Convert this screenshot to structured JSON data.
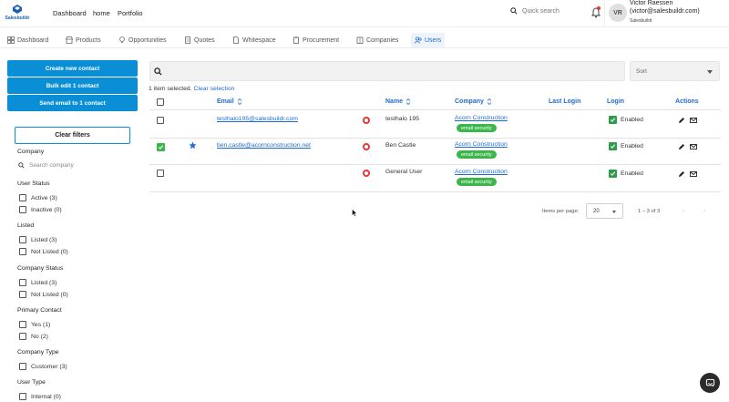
{
  "brand": {
    "logo_text": "Salesbuildr"
  },
  "nav": {
    "items": [
      "Dashboard",
      "home",
      "Portfolio"
    ]
  },
  "search": {
    "placeholder": "Quick search"
  },
  "user": {
    "initials": "VR",
    "name": "Victor Raessen",
    "email": "(victor@salesbuildr.com)",
    "company": "Salesbuildr"
  },
  "tabs": [
    {
      "label": "Dashboard",
      "icon": "grid-icon"
    },
    {
      "label": "Products",
      "icon": "store-icon"
    },
    {
      "label": "Opportunities",
      "icon": "lightbulb-icon"
    },
    {
      "label": "Quotes",
      "icon": "document-icon"
    },
    {
      "label": "Whitespace",
      "icon": "page-icon"
    },
    {
      "label": "Procurement",
      "icon": "clipboard-icon"
    },
    {
      "label": "Companies",
      "icon": "building-icon"
    },
    {
      "label": "Users",
      "icon": "users-icon",
      "active": true
    }
  ],
  "actions": {
    "create": "Create new contact",
    "bulk_edit": "Bulk edit 1 contact",
    "send_email": "Send email to 1 contact",
    "clear_filters": "Clear filters"
  },
  "filters": {
    "company": {
      "label": "Company",
      "search_placeholder": "Search company"
    },
    "user_status": {
      "label": "User Status",
      "options": [
        "Active (3)",
        "Inactive (0)"
      ]
    },
    "listed": {
      "label": "Listed",
      "options": [
        "Listed (3)",
        "Not Listed (0)"
      ]
    },
    "company_status": {
      "label": "Company Status",
      "options": [
        "Listed (3)",
        "Not Listed (0)"
      ]
    },
    "primary_contact": {
      "label": "Primary Contact",
      "options": [
        "Yes (1)",
        "No (2)"
      ]
    },
    "company_type": {
      "label": "Company Type",
      "options": [
        "Customer (3)"
      ]
    },
    "user_type": {
      "label": "User Type",
      "options": [
        "Internal (0)"
      ]
    }
  },
  "main": {
    "sort_label": "Sort",
    "selected_text": "1 item selected.",
    "clear_selection": "Clear selection"
  },
  "table": {
    "headers": {
      "email": "Email",
      "name": "Name",
      "company": "Company",
      "last_login": "Last Login",
      "login": "Login",
      "actions": "Actions"
    },
    "rows": [
      {
        "email": "testhalo195@salesbuildr.com",
        "name": "testhalo 195",
        "company": "Acorn Construction",
        "tag": "email security",
        "login": "Enabled",
        "selected": false,
        "starred": false
      },
      {
        "email": "ben.castle@acornconstruction.net",
        "name": "Ben Castle",
        "company": "Acorn Construction",
        "tag": "email security",
        "login": "Enabled",
        "selected": true,
        "starred": true
      },
      {
        "email": "",
        "name": "General User",
        "company": "Acorn Construction",
        "tag": "email security",
        "login": "Enabled",
        "selected": false,
        "starred": false
      }
    ]
  },
  "pagination": {
    "items_per_page_label": "Items per page:",
    "items_per_page": "20",
    "range": "1 – 3 of 3"
  },
  "colors": {
    "primary": "#0a8fd6",
    "link": "#1e6bd6",
    "tag": "#3cb64b",
    "alert": "#e53935"
  }
}
